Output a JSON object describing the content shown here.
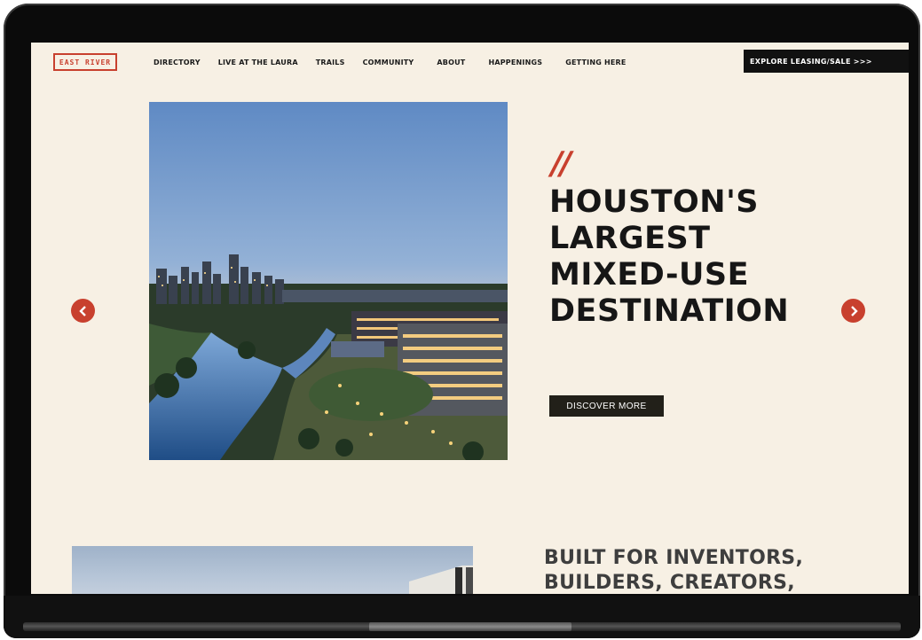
{
  "logo": {
    "text": "EAST RIVER"
  },
  "nav": {
    "links": [
      "DIRECTORY",
      "LIVE AT THE LAURA",
      "TRAILS",
      "COMMUNITY",
      "ABOUT",
      "HAPPENINGS",
      "GETTING HERE"
    ],
    "cta": "EXPLORE LEASING/SALE >>>"
  },
  "hero": {
    "slashes": "//",
    "headline_lines": [
      "HOUSTON'S",
      "LARGEST",
      "MIXED-USE",
      "DESTINATION"
    ],
    "button": "DISCOVER MORE"
  },
  "section2": {
    "headline_lines": [
      "BUILT FOR INVENTORS,",
      "BUILDERS, CREATORS,"
    ]
  },
  "colors": {
    "accent": "#c8402e",
    "background": "#f7f0e4",
    "dark": "#111111"
  },
  "icons": {
    "prev": "chevron-left-icon",
    "next": "chevron-right-icon"
  }
}
